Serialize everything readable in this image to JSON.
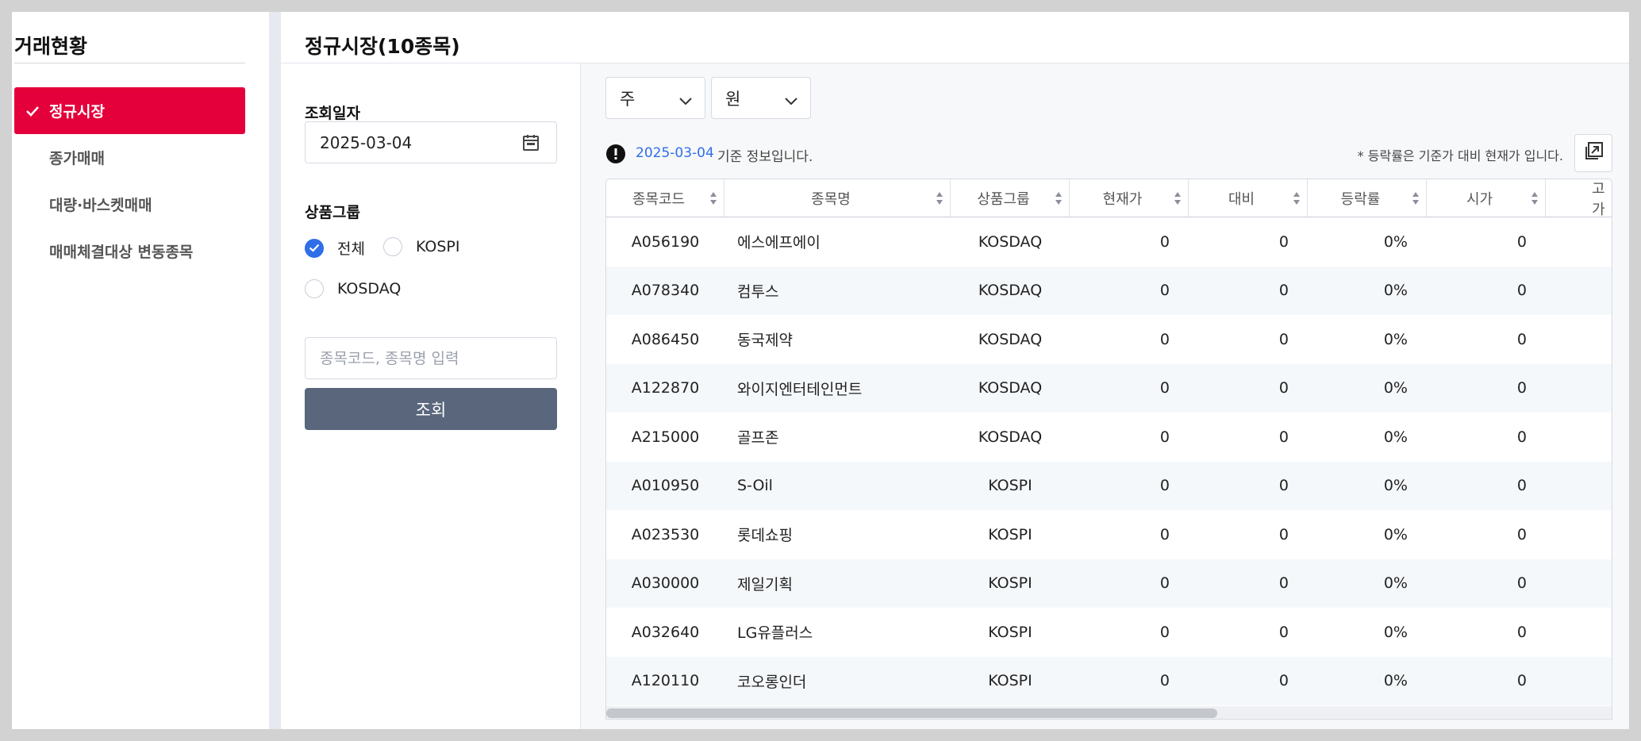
{
  "sidebar": {
    "title": "거래현황",
    "items": [
      {
        "label": "정규시장",
        "active": true
      },
      {
        "label": "종가매매",
        "active": false
      },
      {
        "label": "대량·바스켓매매",
        "active": false
      },
      {
        "label": "매매체결대상 변동종목",
        "active": false
      }
    ]
  },
  "page": {
    "title": "정규시장(10종목)"
  },
  "filters": {
    "date_label": "조회일자",
    "date_value": "2025-03-04",
    "group_label": "상품그룹",
    "radios": [
      {
        "label": "전체",
        "checked": true
      },
      {
        "label": "KOSPI",
        "checked": false
      },
      {
        "label": "KOSDAQ",
        "checked": false
      }
    ],
    "search_placeholder": "종목코드, 종목명 입력",
    "search_button": "조회"
  },
  "controls": {
    "unit_select": "주",
    "currency_select": "원",
    "info_date": "2025-03-04",
    "info_text": "기준 정보입니다.",
    "info_note": "* 등락률은 기준가 대비 현재가 입니다."
  },
  "table": {
    "headers": [
      "종목코드",
      "종목명",
      "상품그룹",
      "현재가",
      "대비",
      "등락률",
      "시가",
      "고가"
    ],
    "rows": [
      {
        "code": "A056190",
        "name": "에스에프에이",
        "group": "KOSDAQ",
        "price": "0",
        "diff": "0",
        "rate": "0%",
        "open": "0"
      },
      {
        "code": "A078340",
        "name": "컴투스",
        "group": "KOSDAQ",
        "price": "0",
        "diff": "0",
        "rate": "0%",
        "open": "0"
      },
      {
        "code": "A086450",
        "name": "동국제약",
        "group": "KOSDAQ",
        "price": "0",
        "diff": "0",
        "rate": "0%",
        "open": "0"
      },
      {
        "code": "A122870",
        "name": "와이지엔터테인먼트",
        "group": "KOSDAQ",
        "price": "0",
        "diff": "0",
        "rate": "0%",
        "open": "0"
      },
      {
        "code": "A215000",
        "name": "골프존",
        "group": "KOSDAQ",
        "price": "0",
        "diff": "0",
        "rate": "0%",
        "open": "0"
      },
      {
        "code": "A010950",
        "name": "S-Oil",
        "group": "KOSPI",
        "price": "0",
        "diff": "0",
        "rate": "0%",
        "open": "0"
      },
      {
        "code": "A023530",
        "name": "롯데쇼핑",
        "group": "KOSPI",
        "price": "0",
        "diff": "0",
        "rate": "0%",
        "open": "0"
      },
      {
        "code": "A030000",
        "name": "제일기획",
        "group": "KOSPI",
        "price": "0",
        "diff": "0",
        "rate": "0%",
        "open": "0"
      },
      {
        "code": "A032640",
        "name": "LG유플러스",
        "group": "KOSPI",
        "price": "0",
        "diff": "0",
        "rate": "0%",
        "open": "0"
      },
      {
        "code": "A120110",
        "name": "코오롱인더",
        "group": "KOSPI",
        "price": "0",
        "diff": "0",
        "rate": "0%",
        "open": "0"
      }
    ]
  },
  "colors": {
    "accent": "#e4003a",
    "primary_blue": "#2f6ee8",
    "button": "#59667c"
  }
}
